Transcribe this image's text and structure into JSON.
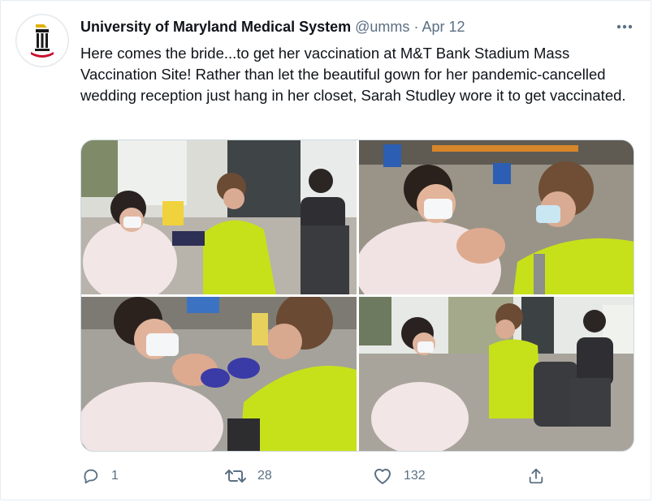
{
  "tweet": {
    "author_name": "University of Maryland Medical System",
    "handle": "@umms",
    "separator": "·",
    "date": "Apr 12",
    "text": "Here comes the bride...to get her vaccination at M&T Bank Stadium Mass Vaccination Site! Rather than let the beautiful gown for her pandemic-cancelled wedding reception just hang in her closet, Sarah Studley wore it to get vaccinated."
  },
  "media": {
    "photos": [
      {
        "icon": "photo-bride-vaccination-wide"
      },
      {
        "icon": "photo-bride-closeup"
      },
      {
        "icon": "photo-bride-injection"
      },
      {
        "icon": "photo-vaccination-room"
      }
    ]
  },
  "actions": {
    "reply_count": "1",
    "retweet_count": "28",
    "like_count": "132"
  },
  "colors": {
    "text_primary": "#0f1419",
    "text_secondary": "#5b7083",
    "safety_vest": "#c6e11a",
    "brand_red": "#c8102e"
  }
}
